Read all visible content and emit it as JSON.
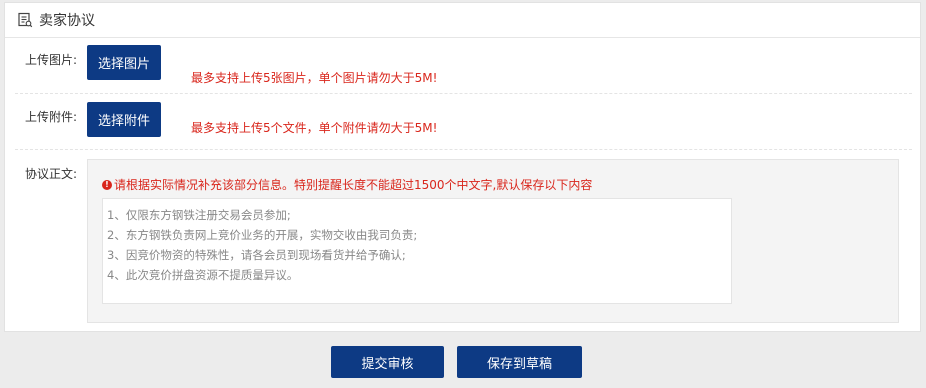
{
  "header": {
    "title": "卖家协议",
    "icon": "document-list-icon"
  },
  "upload_image": {
    "label": "上传图片:",
    "button": "选择图片",
    "hint": "最多支持上传5张图片，单个图片请勿大于5M!"
  },
  "upload_attachment": {
    "label": "上传附件:",
    "button": "选择附件",
    "hint": "最多支持上传5个文件，单个附件请勿大于5M!"
  },
  "agreement": {
    "label": "协议正文:",
    "warning_icon": "exclamation-circle-icon",
    "warning": "请根据实际情况补充该部分信息。特别提醒长度不能超过1500个中文字,默认保存以下内容",
    "placeholder": "1、仅限东方钢铁注册交易会员参加;\n2、东方钢铁负责网上竞价业务的开展，实物交收由我司负责;\n3、因竞价物资的特殊性，请各会员到现场看货并给予确认;\n4、此次竞价拼盘资源不提质量异议。"
  },
  "footer": {
    "submit": "提交审核",
    "save_draft": "保存到草稿"
  },
  "colors": {
    "primary": "#0d3a84",
    "warning": "#d9261c"
  }
}
